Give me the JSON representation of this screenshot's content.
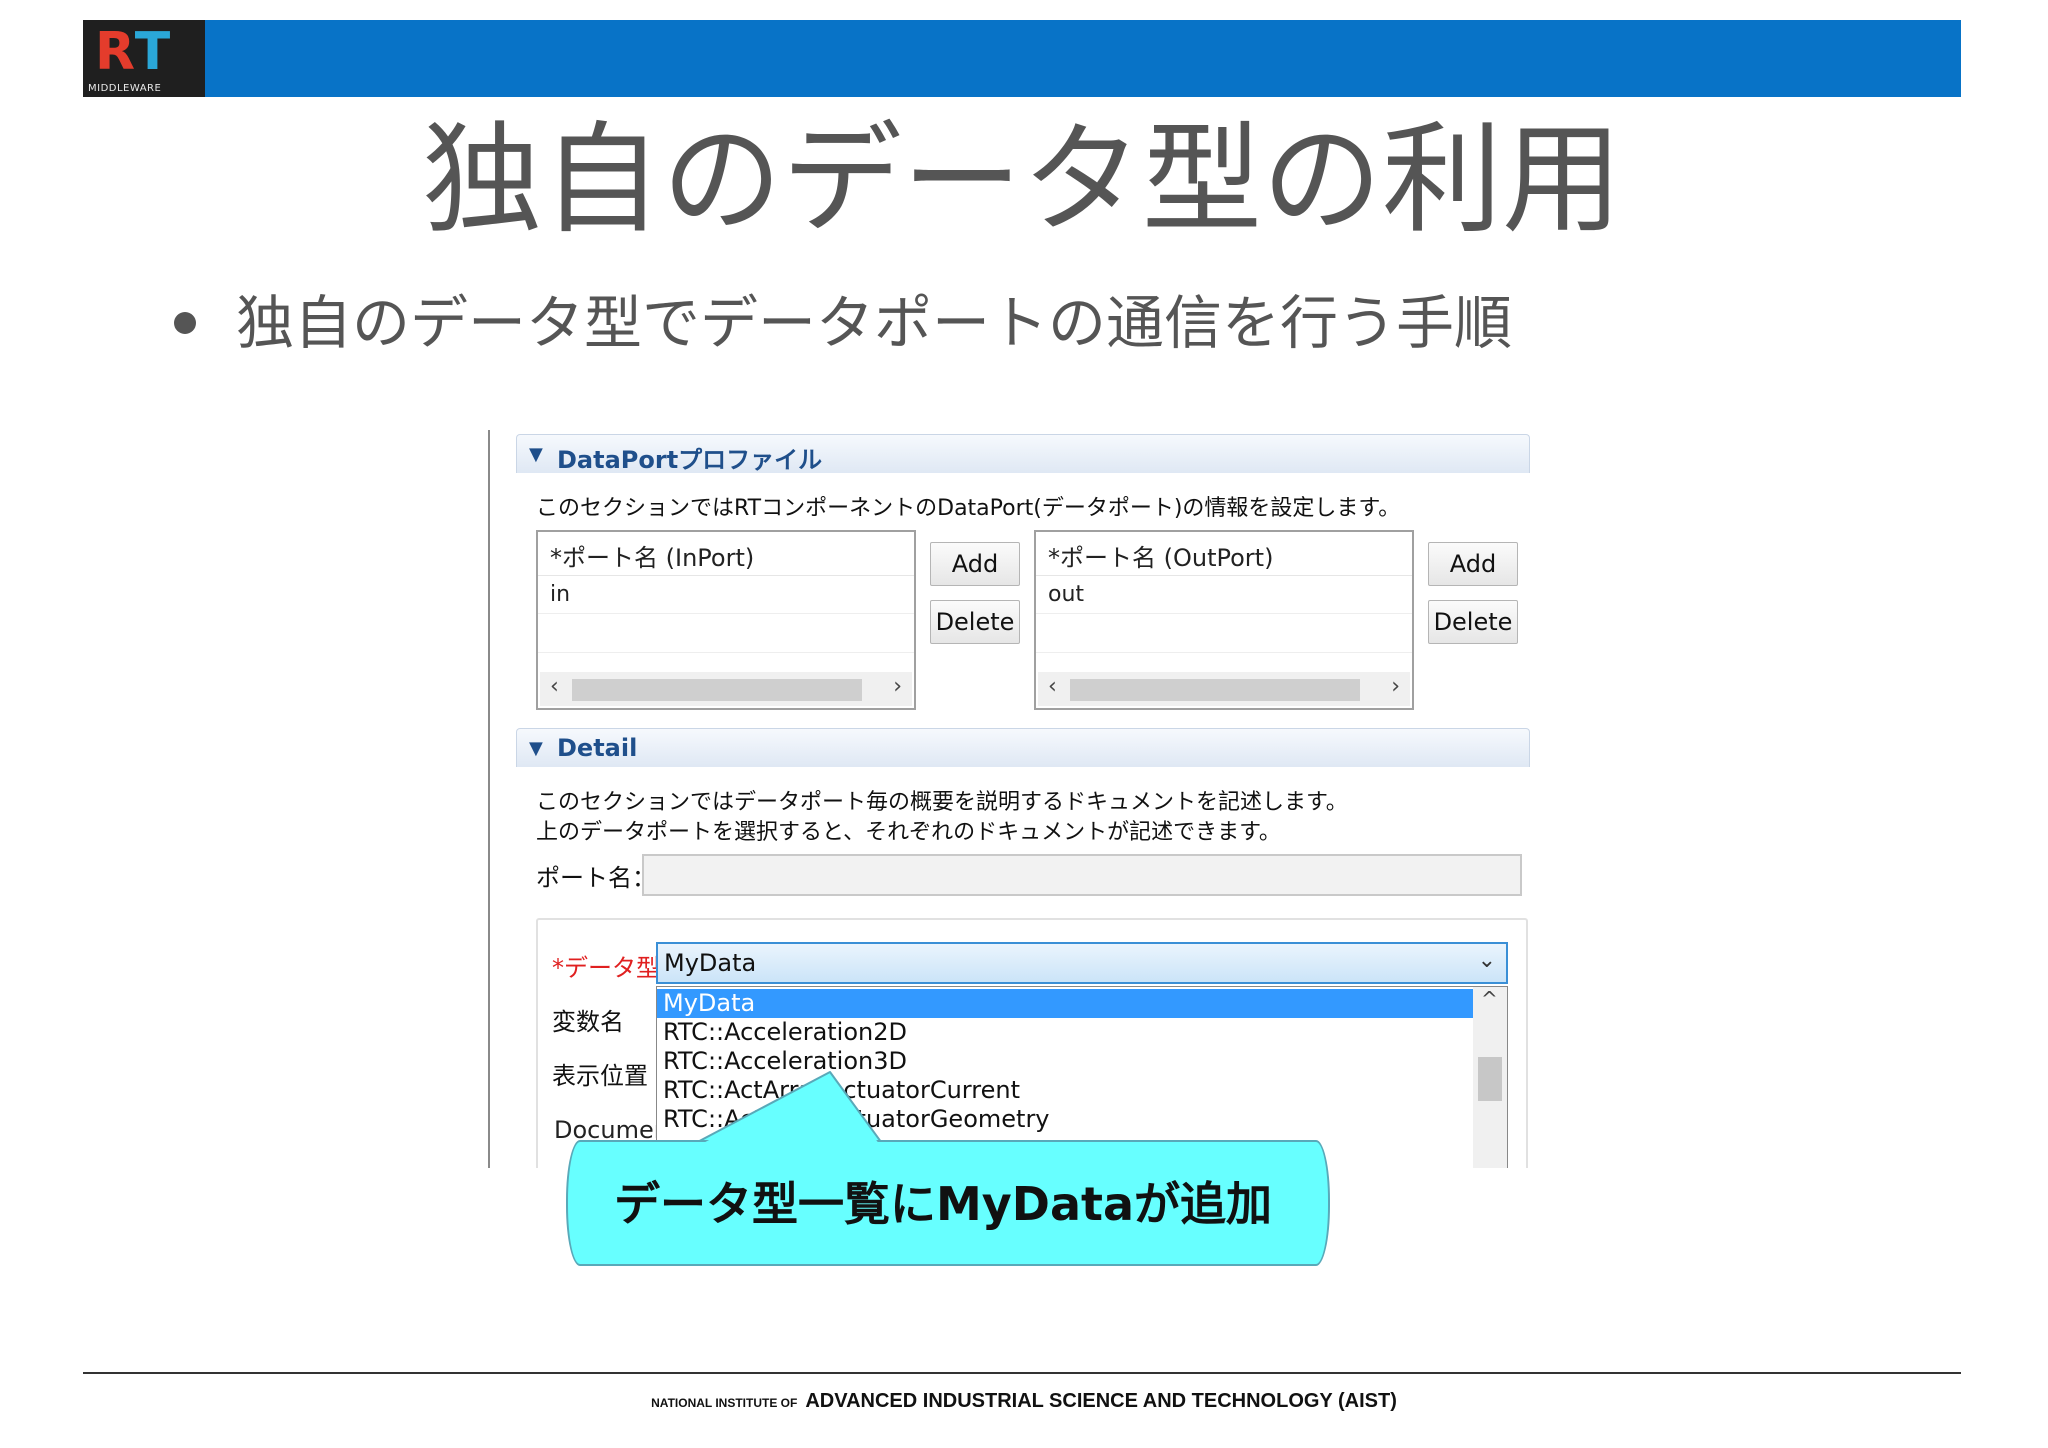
{
  "logo": {
    "mark_r": "R",
    "mark_t": "T",
    "subtitle": "MIDDLEWARE"
  },
  "colors": {
    "banner": "#0873c7",
    "callout": "#67ffff",
    "selection": "#3399ff",
    "required_label": "#e02020"
  },
  "slide": {
    "title": "独自のデータ型の利用",
    "bullet": "独自のデータ型でデータポートの通信を行う手順"
  },
  "dialog": {
    "dataport_section": {
      "title": "DataPortプロファイル",
      "description": "このセクションではRTコンポーネントのDataPort(データポート)の情報を設定します。",
      "inport_header": "*ポート名 (InPort)",
      "inport_items": [
        "in"
      ],
      "outport_header": "*ポート名 (OutPort)",
      "outport_items": [
        "out"
      ],
      "add_label": "Add",
      "delete_label": "Delete"
    },
    "detail_section": {
      "title": "Detail",
      "description_line1": "このセクションではデータポート毎の概要を説明するドキュメントを記述します。",
      "description_line2": "上のデータポートを選択すると、それぞれのドキュメントが記述できます。",
      "port_name_label": "ポート名：",
      "port_name_value": "",
      "datatype_label": "*データ型",
      "datatype_value": "MyData",
      "variable_label": "変数名",
      "position_label": "表示位置",
      "documentation_label": "Documer",
      "dropdown_options": [
        "MyData",
        "RTC::Acceleration2D",
        "RTC::Acceleration3D",
        "RTC::ActArrayActuatorCurrent",
        "RTC::ActArrayActuatorGeometry"
      ]
    }
  },
  "callout": {
    "text": "データ型一覧にMyDataが追加"
  },
  "footer": {
    "small": "NATIONAL INSTITUTE OF",
    "main": "ADVANCED INDUSTRIAL SCIENCE AND TECHNOLOGY (AIST)"
  }
}
